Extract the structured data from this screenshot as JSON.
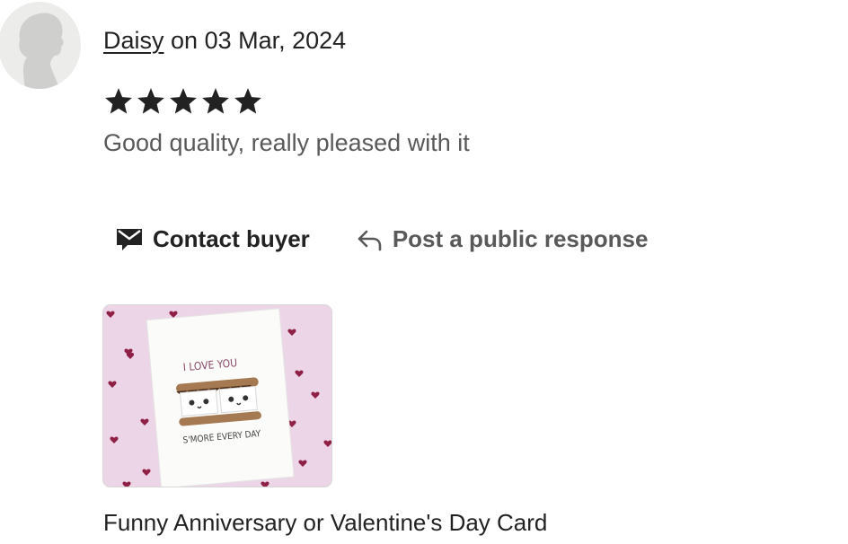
{
  "review": {
    "author": "Daisy",
    "date_prefix": " on ",
    "date": "03 Mar, 2024",
    "rating": 5,
    "rating_max": 5,
    "text": "Good quality, really pleased with it"
  },
  "actions": {
    "contact_label": "Contact buyer",
    "contact_icon": "envelope-icon",
    "respond_label": "Post a public response",
    "respond_icon": "reply-arrow-icon"
  },
  "listing": {
    "title": "Funny Anniversary or Valentine's Day Card",
    "card_text_top": "I LOVE YOU",
    "card_text_bottom": "S'MORE EVERY DAY"
  },
  "colors": {
    "text_primary": "#222222",
    "text_secondary": "#595959",
    "avatar_bg": "#ececea",
    "avatar_silhouette": "#cfcfcd",
    "thumb_bg": "#ecd5e6",
    "heart": "#8e1f45"
  }
}
